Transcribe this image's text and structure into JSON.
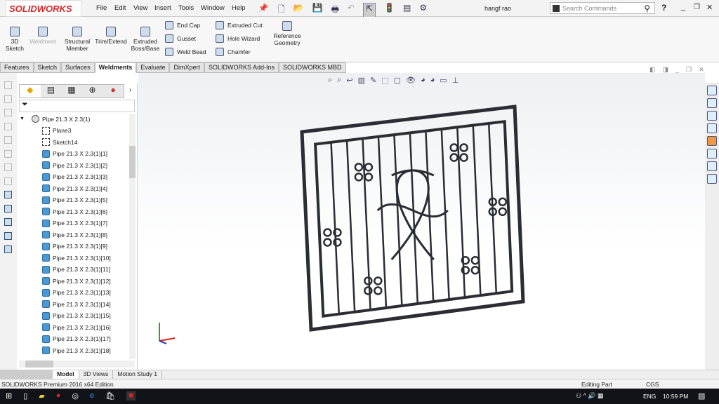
{
  "app": {
    "logo": "SOLIDWORKS",
    "user": "hangf rao",
    "search_placeholder": "Search Commands"
  },
  "menu": [
    "File",
    "Edit",
    "View",
    "Insert",
    "Tools",
    "Window",
    "Help"
  ],
  "ribbon": {
    "large": [
      {
        "label": "3D Sketch"
      },
      {
        "label": "Weldment",
        "disabled": true
      },
      {
        "label": "Structural Member"
      },
      {
        "label": "Trim/Extend"
      },
      {
        "label": "Extruded Boss/Base"
      }
    ],
    "small_col1": [
      "End Cap",
      "Gusset",
      "Weld Bead"
    ],
    "small_col2": [
      "Extruded Cut",
      "Hole Wizard",
      "Chamfer"
    ],
    "ref": "Reference Geometry"
  },
  "tabs": [
    "Features",
    "Sketch",
    "Surfaces",
    "Weldments",
    "Evaluate",
    "DimXpert",
    "SOLIDWORKS Add-Ins",
    "SOLIDWORKS MBD"
  ],
  "active_tab": "Weldments",
  "tree": {
    "root": "Pipe 21.3 X 2.3(1)",
    "children": [
      "Plane3",
      "Sketch14"
    ],
    "bodies": [
      "Pipe 21.3 X 2.3(1)[1]",
      "Pipe 21.3 X 2.3(1)[2]",
      "Pipe 21.3 X 2.3(1)[3]",
      "Pipe 21.3 X 2.3(1)[4]",
      "Pipe 21.3 X 2.3(1)[5]",
      "Pipe 21.3 X 2.3(1)[6]",
      "Pipe 21.3 X 2.3(1)[7]",
      "Pipe 21.3 X 2.3(1)[8]",
      "Pipe 21.3 X 2.3(1)[9]",
      "Pipe 21.3 X 2.3(1)[10]",
      "Pipe 21.3 X 2.3(1)[11]",
      "Pipe 21.3 X 2.3(1)[12]",
      "Pipe 21.3 X 2.3(1)[13]",
      "Pipe 21.3 X 2.3(1)[14]",
      "Pipe 21.3 X 2.3(1)[15]",
      "Pipe 21.3 X 2.3(1)[16]",
      "Pipe 21.3 X 2.3(1)[17]",
      "Pipe 21.3 X 2.3(1)[18]"
    ]
  },
  "bottom_tabs": [
    "Model",
    "3D Views",
    "Motion Study 1"
  ],
  "status": {
    "edition": "SOLIDWORKS Premium 2016 x64 Edition",
    "mode": "Editing Part",
    "units": "CGS"
  },
  "taskbar": {
    "lang": "ENG",
    "time": "10:59 PM"
  },
  "colors": {
    "accent": "#d5282a",
    "body_icon": "#4a9ad6"
  }
}
